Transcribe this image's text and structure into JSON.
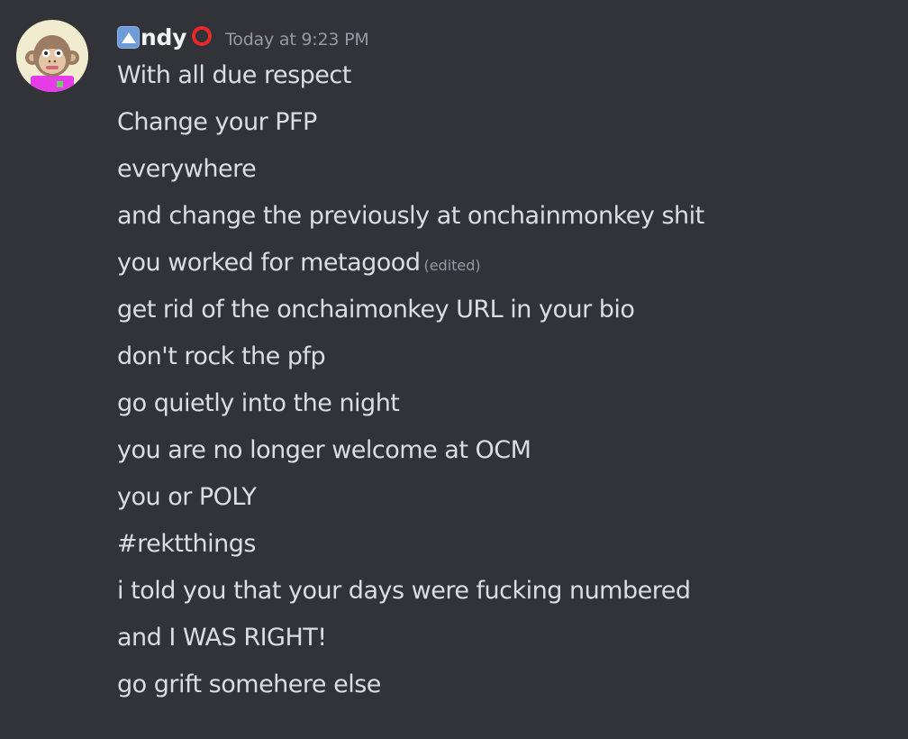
{
  "author": {
    "name_prefix_emoji": "up-button-emoji",
    "name": "ndy",
    "name_suffix_emoji": "hollow-red-circle-emoji",
    "timestamp": "Today at 9:23 PM"
  },
  "messages": [
    {
      "text": "With all due respect",
      "edited": ""
    },
    {
      "text": "Change your PFP",
      "edited": ""
    },
    {
      "text": "everywhere",
      "edited": ""
    },
    {
      "text": "and change the previously at onchainmonkey shit",
      "edited": ""
    },
    {
      "text": "you worked for metagood",
      "edited": "(edited)"
    },
    {
      "text": "get rid of the onchaimonkey URL in your bio",
      "edited": ""
    },
    {
      "text": "don't rock the pfp",
      "edited": ""
    },
    {
      "text": "go quietly into the night",
      "edited": ""
    },
    {
      "text": "you are no longer welcome at OCM",
      "edited": ""
    },
    {
      "text": "you or POLY",
      "edited": ""
    },
    {
      "text": "#rektthings",
      "edited": ""
    },
    {
      "text": "i told you that your days were fucking numbered",
      "edited": ""
    },
    {
      "text": "and I WAS RIGHT!",
      "edited": ""
    },
    {
      "text": "go grift somehere else",
      "edited": ""
    }
  ],
  "colors": {
    "background": "#313338",
    "text": "#dbdee1",
    "username": "#f2f3f5",
    "muted": "#949ba4"
  }
}
